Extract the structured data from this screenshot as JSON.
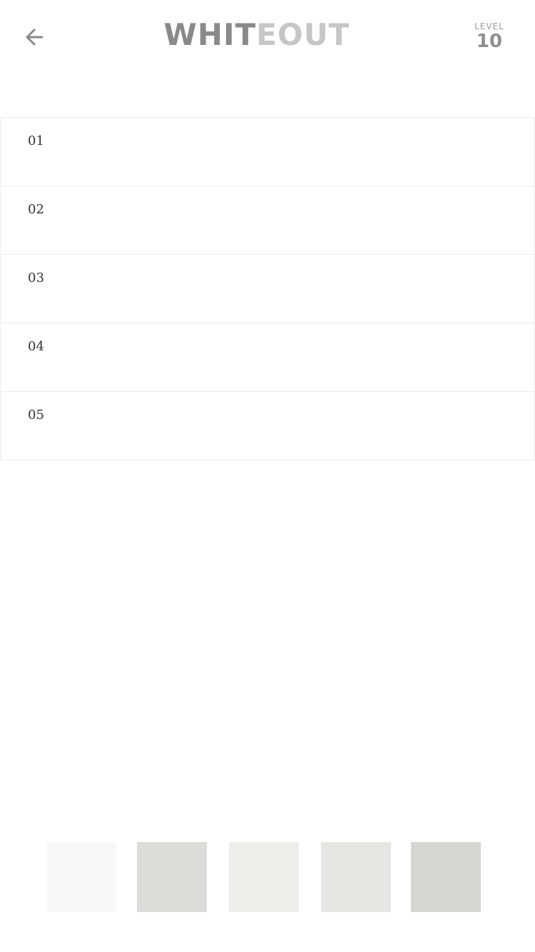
{
  "header": {
    "title_dark": "WHIT",
    "title_light": "EOUT",
    "level_label": "LEVEL",
    "level_value": "10",
    "back_icon": "arrow-left-icon"
  },
  "rows": [
    {
      "label": "01"
    },
    {
      "label": "02"
    },
    {
      "label": "03"
    },
    {
      "label": "04"
    },
    {
      "label": "05"
    }
  ],
  "palette": {
    "colors": [
      "#f8f8f6",
      "#dcdcd8",
      "#eeeeea",
      "#e6e6e2",
      "#d6d6d2"
    ]
  },
  "colors": {
    "title": "#8a8a8a",
    "title_light": "#c6c6c6",
    "row_border": "#ededed"
  }
}
